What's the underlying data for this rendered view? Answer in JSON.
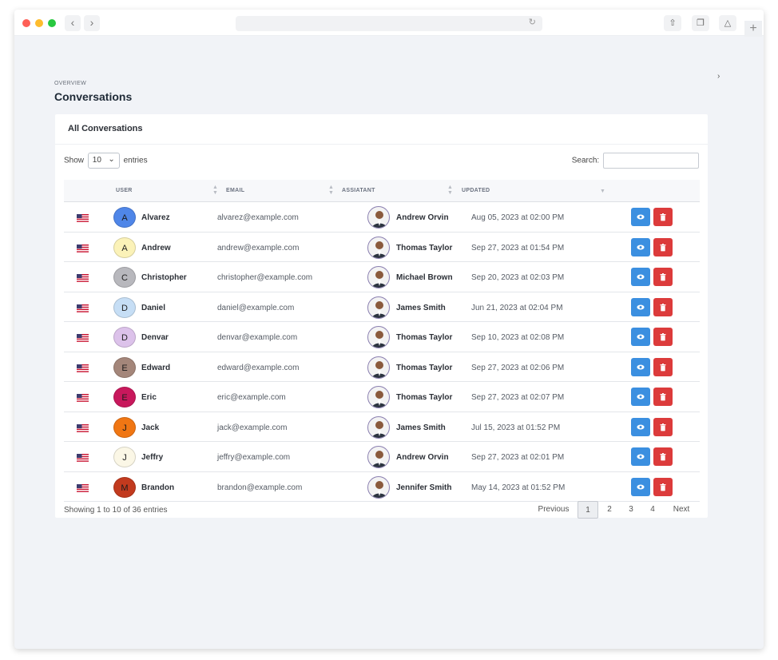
{
  "header": {
    "overview": "OVERVIEW",
    "title": "Conversations"
  },
  "card": {
    "title": "All Conversations"
  },
  "controls": {
    "show_label": "Show",
    "show_value": "10",
    "entries_label": "entries",
    "search_label": "Search:"
  },
  "columns": {
    "user": "USER",
    "email": "EMAIL",
    "assistant": "ASSIATANT",
    "updated": "UPDATED"
  },
  "rows": [
    {
      "initial": "A",
      "name": "Alvarez",
      "email": "alvarez@example.com",
      "assistant": "Andrew Orvin",
      "updated": "Aug 05, 2023 at 02:00 PM",
      "color": "#4f86e8"
    },
    {
      "initial": "A",
      "name": "Andrew",
      "email": "andrew@example.com",
      "assistant": "Thomas Taylor",
      "updated": "Sep 27, 2023 at 01:54 PM",
      "color": "#fbf2b8"
    },
    {
      "initial": "C",
      "name": "Christopher",
      "email": "christopher@example.com",
      "assistant": "Michael Brown",
      "updated": "Sep 20, 2023 at 02:03 PM",
      "color": "#b8b8bd"
    },
    {
      "initial": "D",
      "name": "Daniel",
      "email": "daniel@example.com",
      "assistant": "James Smith",
      "updated": "Jun 21, 2023 at 02:04 PM",
      "color": "#c6def5"
    },
    {
      "initial": "D",
      "name": "Denvar",
      "email": "denvar@example.com",
      "assistant": "Thomas Taylor",
      "updated": "Sep 10, 2023 at 02:08 PM",
      "color": "#dcc2ea"
    },
    {
      "initial": "E",
      "name": "Edward",
      "email": "edward@example.com",
      "assistant": "Thomas Taylor",
      "updated": "Sep 27, 2023 at 02:06 PM",
      "color": "#a4867a"
    },
    {
      "initial": "E",
      "name": "Eric",
      "email": "eric@example.com",
      "assistant": "Thomas Taylor",
      "updated": "Sep 27, 2023 at 02:07 PM",
      "color": "#c8185c"
    },
    {
      "initial": "J",
      "name": "Jack",
      "email": "jack@example.com",
      "assistant": "James Smith",
      "updated": "Jul 15, 2023 at 01:52 PM",
      "color": "#f07613"
    },
    {
      "initial": "J",
      "name": "Jeffry",
      "email": "jeffry@example.com",
      "assistant": "Andrew Orvin",
      "updated": "Sep 27, 2023 at 02:01 PM",
      "color": "#fbf7e6"
    },
    {
      "initial": "M",
      "name": "Brandon",
      "email": "brandon@example.com",
      "assistant": "Jennifer Smith",
      "updated": "May 14, 2023 at 01:52 PM",
      "color": "#c23a1e"
    }
  ],
  "footer": {
    "info": "Showing 1 to 10 of 36 entries"
  },
  "pagination": {
    "previous": "Previous",
    "pages": [
      "1",
      "2",
      "3",
      "4"
    ],
    "active": "1",
    "next": "Next"
  },
  "icons": {
    "view": "eye-icon",
    "delete": "trash-icon",
    "flag": "us-flag-icon"
  },
  "colors": {
    "view_button": "#3b8fe0",
    "delete_button": "#dc3b3b"
  }
}
